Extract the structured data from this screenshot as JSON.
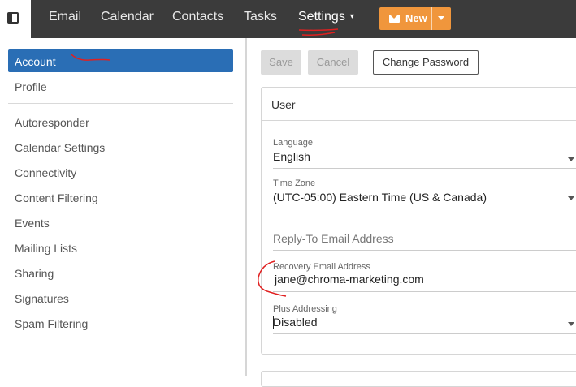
{
  "topbar": {
    "nav": [
      {
        "label": "Email"
      },
      {
        "label": "Calendar"
      },
      {
        "label": "Contacts"
      },
      {
        "label": "Tasks"
      },
      {
        "label": "Settings",
        "caret": "▾"
      }
    ],
    "new_button": {
      "label": "New"
    }
  },
  "sidebar": {
    "items": [
      {
        "label": "Account"
      },
      {
        "label": "Profile"
      },
      {
        "label": "Autoresponder"
      },
      {
        "label": "Calendar Settings"
      },
      {
        "label": "Connectivity"
      },
      {
        "label": "Content Filtering"
      },
      {
        "label": "Events"
      },
      {
        "label": "Mailing Lists"
      },
      {
        "label": "Sharing"
      },
      {
        "label": "Signatures"
      },
      {
        "label": "Spam Filtering"
      }
    ]
  },
  "toolbar": {
    "save_label": "Save",
    "cancel_label": "Cancel",
    "change_password_label": "Change Password"
  },
  "user_card": {
    "title": "User",
    "language": {
      "label": "Language",
      "value": "English"
    },
    "time_zone": {
      "label": "Time Zone",
      "value": "(UTC-05:00) Eastern Time (US & Canada)"
    },
    "reply_to": {
      "placeholder": "Reply-To Email Address"
    },
    "recovery_email": {
      "label": "Recovery Email Address",
      "value": "jane@chroma-marketing.com"
    },
    "plus_addressing": {
      "label": "Plus Addressing",
      "value": "Disabled"
    }
  },
  "colors": {
    "topbar": "#3b3b3b",
    "accent": "#2a6eb5",
    "new_button": "#f0963c",
    "annotation": "#e02020"
  }
}
